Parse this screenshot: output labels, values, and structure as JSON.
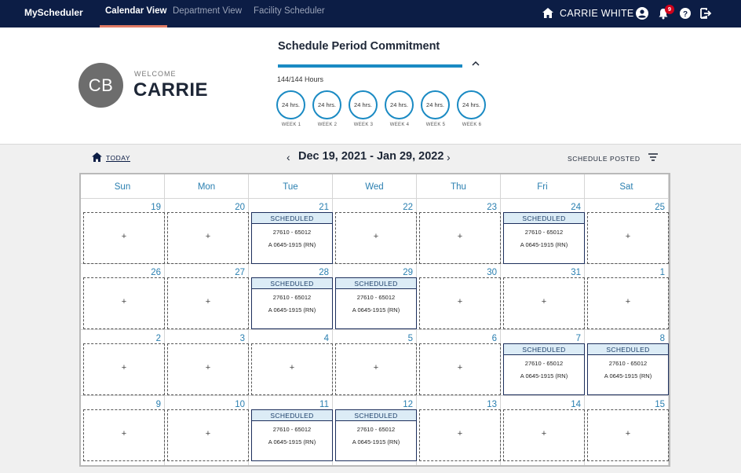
{
  "nav": {
    "brand": "MyScheduler",
    "links": [
      {
        "label": "Calendar View",
        "active": true
      },
      {
        "label": "Department View",
        "active": false
      },
      {
        "label": "Facility Scheduler",
        "active": false
      }
    ],
    "user_name": "CARRIE WHITE",
    "notification_count": "9",
    "icons": [
      "home-icon",
      "user-circle-icon",
      "bell-icon",
      "help-icon",
      "logout-icon"
    ]
  },
  "profile": {
    "initials": "CB",
    "welcome": "WELCOME",
    "first_name": "CARRIE"
  },
  "commitment": {
    "title": "Schedule Period Commitment",
    "hours_text": "144/144 Hours",
    "progress": 1.0,
    "weeks": [
      {
        "hours": "24 hrs.",
        "label": "WEEK 1"
      },
      {
        "hours": "24 hrs.",
        "label": "WEEK 2"
      },
      {
        "hours": "24 hrs.",
        "label": "WEEK 3"
      },
      {
        "hours": "24 hrs.",
        "label": "WEEK 4"
      },
      {
        "hours": "24 hrs.",
        "label": "WEEK 5"
      },
      {
        "hours": "24 hrs.",
        "label": "WEEK 6"
      }
    ]
  },
  "toolbar": {
    "today": "TODAY",
    "prev": "‹",
    "next": "›",
    "range": "Dec 19, 2021 - Jan 29, 2022",
    "status": "SCHEDULE POSTED"
  },
  "calendar": {
    "days_of_week": [
      "Sun",
      "Mon",
      "Tue",
      "Wed",
      "Thu",
      "Fri",
      "Sat"
    ],
    "empty_symbol": "+",
    "weeks": [
      [
        {
          "day": "19",
          "shift": null
        },
        {
          "day": "20",
          "shift": null
        },
        {
          "day": "21",
          "shift": {
            "status": "SCHEDULED",
            "code": "27610 - 65012",
            "time": "A 0645-1915 (RN)"
          }
        },
        {
          "day": "22",
          "shift": null
        },
        {
          "day": "23",
          "shift": null
        },
        {
          "day": "24",
          "shift": {
            "status": "SCHEDULED",
            "code": "27610 - 65012",
            "time": "A 0645-1915 (RN)"
          }
        },
        {
          "day": "25",
          "shift": null
        }
      ],
      [
        {
          "day": "26",
          "shift": null
        },
        {
          "day": "27",
          "shift": null
        },
        {
          "day": "28",
          "shift": {
            "status": "SCHEDULED",
            "code": "27610 - 65012",
            "time": "A 0645-1915 (RN)"
          }
        },
        {
          "day": "29",
          "shift": {
            "status": "SCHEDULED",
            "code": "27610 - 65012",
            "time": "A 0645-1915 (RN)"
          }
        },
        {
          "day": "30",
          "shift": null
        },
        {
          "day": "31",
          "shift": null
        },
        {
          "day": "1",
          "shift": null
        }
      ],
      [
        {
          "day": "2",
          "shift": null
        },
        {
          "day": "3",
          "shift": null
        },
        {
          "day": "4",
          "shift": null
        },
        {
          "day": "5",
          "shift": null
        },
        {
          "day": "6",
          "shift": null
        },
        {
          "day": "7",
          "shift": {
            "status": "SCHEDULED",
            "code": "27610 - 65012",
            "time": "A 0645-1915 (RN)"
          }
        },
        {
          "day": "8",
          "shift": {
            "status": "SCHEDULED",
            "code": "27610 - 65012",
            "time": "A 0645-1915 (RN)"
          }
        }
      ],
      [
        {
          "day": "9",
          "shift": null
        },
        {
          "day": "10",
          "shift": null
        },
        {
          "day": "11",
          "shift": {
            "status": "SCHEDULED",
            "code": "27610 - 65012",
            "time": "A 0645-1915 (RN)"
          }
        },
        {
          "day": "12",
          "shift": {
            "status": "SCHEDULED",
            "code": "27610 - 65012",
            "time": "A 0645-1915 (RN)"
          }
        },
        {
          "day": "13",
          "shift": null
        },
        {
          "day": "14",
          "shift": null
        },
        {
          "day": "15",
          "shift": null
        }
      ]
    ]
  },
  "colors": {
    "nav_bg": "#0c1d45",
    "accent": "#1a8ac3",
    "active_underline": "#e07a64",
    "badge": "#d0021b"
  }
}
